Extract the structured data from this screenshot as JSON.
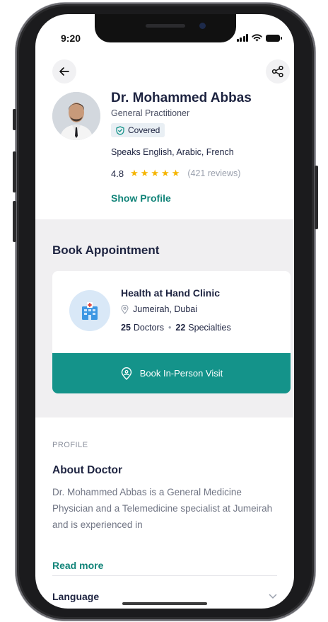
{
  "status_bar": {
    "time": "9:20"
  },
  "doctor": {
    "name": "Dr. Mohammed Abbas",
    "specialty": "General Practitioner",
    "badge": "Covered",
    "languages": "Speaks English, Arabic, French",
    "rating": "4.8",
    "rating_value": 5,
    "stars": "★★★★★",
    "reviews": "(421 reviews)",
    "show_profile": "Show Profile"
  },
  "booking": {
    "title": "Book Appointment",
    "clinic": {
      "name": "Health at Hand Clinic",
      "location": "Jumeirah, Dubai",
      "doctors_count": "25",
      "doctors_label": "Doctors",
      "specialties_count": "22",
      "specialties_label": "Specialties"
    },
    "button_label": "Book In-Person Visit"
  },
  "profile": {
    "section_label": "PROFILE",
    "about_title": "About Doctor",
    "about_text": "Dr. Mohammed Abbas  is a General Medicine Physician and a Telemedicine specialist at Jumeirah and is experienced in",
    "read_more": "Read more",
    "language_label": "Language"
  },
  "colors": {
    "accent": "#14938a",
    "accent_text": "#128479",
    "star": "#f5b400",
    "section_bg": "#f0eff1"
  },
  "icons": [
    "back-arrow-icon",
    "share-icon",
    "shield-check-icon",
    "star-icon",
    "location-pin-icon",
    "hospital-icon",
    "chevron-down-icon"
  ]
}
